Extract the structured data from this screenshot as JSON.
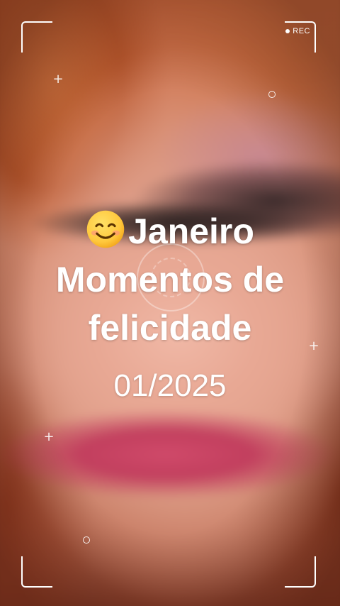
{
  "recorder": {
    "rec_label": "REC"
  },
  "overlay": {
    "emoji_icon": "smiling-face-icon",
    "title_word": "Janeiro",
    "caption_line_2": "Momentos de",
    "caption_line_3": "felicidade",
    "date": "01/2025"
  },
  "colors": {
    "text": "#ffffff",
    "emoji_face": "#ffc83d"
  }
}
